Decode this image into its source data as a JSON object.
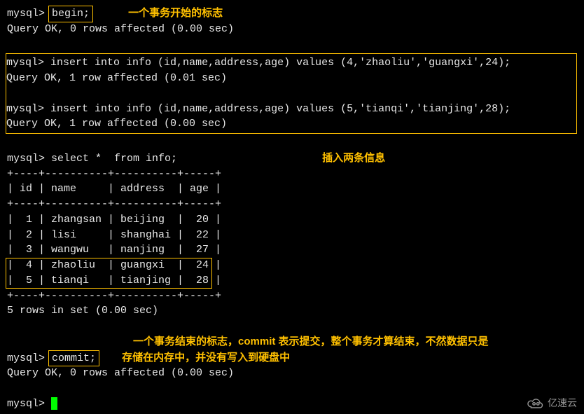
{
  "prompt": "mysql>",
  "begin": {
    "cmd": "begin;",
    "annotation": "一个事务开始的标志",
    "result": "Query OK, 0 rows affected (0.00 sec)"
  },
  "inserts": {
    "annotation": "插入两条信息",
    "stmt1": "insert into info (id,name,address,age) values (4,'zhaoliu','guangxi',24);",
    "result1": "Query OK, 1 row affected (0.01 sec)",
    "stmt2": "insert into info (id,name,address,age) values (5,'tianqi','tianjing',28);",
    "result2": "Query OK, 1 row affected (0.00 sec)"
  },
  "select": {
    "cmd": "select *  from info;",
    "border_top": "+----+----------+----------+-----+",
    "header": "| id | name     | address  | age |",
    "border_mid": "+----+----------+----------+-----+",
    "rows": [
      "|  1 | zhangsan | beijing  |  20 |",
      "|  2 | lisi     | shanghai |  22 |",
      "|  3 | wangwu   | nanjing  |  27 |",
      "|  4 | zhaoliu  | guangxi  |  24 |",
      "|  5 | tianqi   | tianjing |  28 |"
    ],
    "border_bot": "+----+----------+----------+-----+",
    "summary": "5 rows in set (0.00 sec)"
  },
  "commit": {
    "cmd": "commit;",
    "annotation_line1": "一个事务结束的标志，commit 表示提交，整个事务才算结束，不然数据只是",
    "annotation_line2": "存储在内存中，并没有写入到硬盘中",
    "result": "Query OK, 0 rows affected (0.00 sec)"
  },
  "watermark": "亿速云",
  "chart_data": {
    "type": "table",
    "title": "info",
    "columns": [
      "id",
      "name",
      "address",
      "age"
    ],
    "rows": [
      {
        "id": 1,
        "name": "zhangsan",
        "address": "beijing",
        "age": 20
      },
      {
        "id": 2,
        "name": "lisi",
        "address": "shanghai",
        "age": 22
      },
      {
        "id": 3,
        "name": "wangwu",
        "address": "nanjing",
        "age": 27
      },
      {
        "id": 4,
        "name": "zhaoliu",
        "address": "guangxi",
        "age": 24
      },
      {
        "id": 5,
        "name": "tianqi",
        "address": "tianjing",
        "age": 28
      }
    ]
  }
}
